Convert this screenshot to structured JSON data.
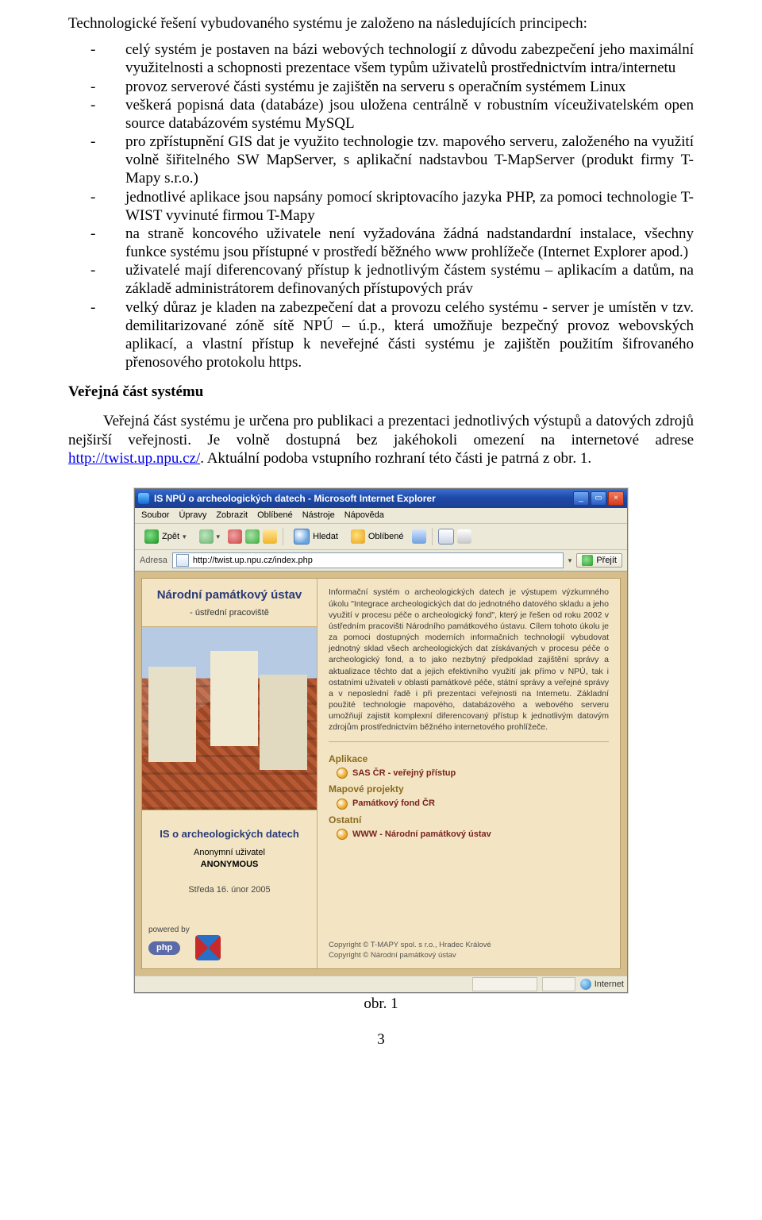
{
  "intro": "Technologické řešení vybudovaného systému je založeno na následujících principech:",
  "bullets": [
    "celý systém je postaven na bázi webových technologií z důvodu zabezpečení jeho maximální využitelnosti a schopnosti prezentace všem typům uživatelů prostřednictvím intra/internetu",
    "provoz serverové části systému je zajištěn na serveru s operačním systémem Linux",
    "veškerá popisná data (databáze) jsou uložena centrálně v robustním víceuživatelském open source databázovém systému MySQL",
    "pro zpřístupnění GIS dat je využito technologie tzv. mapového serveru, založeného na využití volně šiřitelného SW MapServer, s aplikační nadstavbou T-MapServer (produkt firmy T-Mapy s.r.o.)",
    "jednotlivé aplikace jsou napsány pomocí skriptovacího jazyka PHP, za pomoci technologie T-WIST vyvinuté firmou T-Mapy",
    "na straně koncového uživatele není vyžadována žádná nadstandardní instalace, všechny funkce systému jsou přístupné v prostředí běžného www prohlížeče (Internet Explorer apod.)",
    "uživatelé mají diferencovaný přístup k jednotlivým částem systému – aplikacím a datům, na základě administrátorem definovaných přístupových práv",
    "velký důraz je kladen na zabezpečení dat a provozu celého systému - server je umístěn v tzv. demilitarizované zóně sítě NPÚ – ú.p., která umožňuje bezpečný provoz webovských aplikací, a vlastní přístup k neveřejné části systému je zajištěn použitím šifrovaného přenosového protokolu https."
  ],
  "section_title": "Veřejná část systému",
  "section_para_pre": "Veřejná část systému je určena pro publikaci a prezentaci jednotlivých výstupů a datových zdrojů nejširší veřejnosti. Je volně dostupná bez jakéhokoli omezení na internetové adrese ",
  "section_link_text": "http://twist.up.npu.cz/",
  "section_para_post": ". Aktuální podoba vstupního rozhraní této části je patrná z obr. 1.",
  "browser": {
    "window_title": "IS NPÚ o archeologických datech - Microsoft Internet Explorer",
    "menu": [
      "Soubor",
      "Úpravy",
      "Zobrazit",
      "Oblíbené",
      "Nástroje",
      "Nápověda"
    ],
    "tb_back": "Zpět",
    "tb_search": "Hledat",
    "tb_fav": "Oblíbené",
    "addr_label": "Adresa",
    "url": "http://twist.up.npu.cz/index.php",
    "go_label": "Přejít",
    "left": {
      "title": "Národní památkový ústav",
      "subtitle": "- ústřední pracoviště",
      "box_title": "IS o archeologických datech",
      "anon_label": "Anonymní uživatel",
      "anon_user": "ANONYMOUS",
      "date": "Středa 16. únor 2005",
      "powered": "powered by",
      "php": "php"
    },
    "right": {
      "desc": "Informační systém o archeologických datech je výstupem výzkumného úkolu \"Integrace archeologických dat do jednotného datového skladu a jeho využití v procesu péče o archeologický fond\", který je řešen od roku 2002 v ústředním pracovišti Národního památkového ústavu. Cílem tohoto úkolu je za pomoci dostupných moderních informačních technologií vybudovat jednotný sklad všech archeologických dat získávaných v procesu péče o archeologický fond, a to jako nezbytný předpoklad zajištění správy a aktualizace těchto dat a jejich efektivního využití jak přímo v NPÚ, tak i ostatními uživateli v oblasti památkové péče, státní správy a veřejné správy a v neposlední řadě i při prezentaci veřejnosti na Internetu. Základní použité technologie mapového, databázového a webového serveru umožňují zajistit komplexní diferencovaný přístup k jednotlivým datovým zdrojům prostřednictvím běžného internetového prohlížeče.",
      "sec_app": "Aplikace",
      "lk_app": "SAS ČR - veřejný přístup",
      "sec_map": "Mapové projekty",
      "lk_map": "Památkový fond ČR",
      "sec_other": "Ostatní",
      "lk_other": "WWW - Národní památkový ústav",
      "copy1": "Copyright © T-MAPY spol. s r.o., Hradec Králové",
      "copy2": "Copyright © Národní památkový ústav"
    },
    "status_net": "Internet"
  },
  "fig_caption": "obr. 1",
  "page_number": "3"
}
